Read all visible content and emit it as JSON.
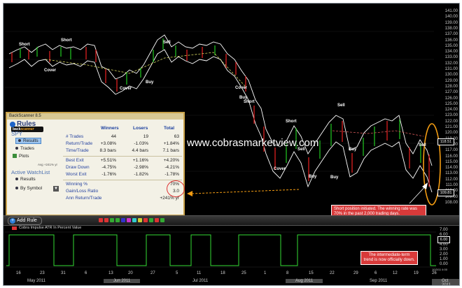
{
  "watermark": "www.cobrasmarketview.com",
  "y_axis_labels": [
    "141.00",
    "140.00",
    "139.00",
    "138.00",
    "137.00",
    "136.00",
    "135.00",
    "134.00",
    "133.00",
    "132.00",
    "131.00",
    "130.00",
    "129.00",
    "128.00",
    "127.00",
    "126.00",
    "125.00",
    "124.00",
    "123.00",
    "122.00",
    "121.00",
    "120.00",
    "119.00",
    "118.00",
    "117.00",
    "116.00",
    "115.00",
    "114.00",
    "113.00",
    "112.00",
    "111.00",
    "110.00",
    "109.00",
    "108.00"
  ],
  "price_boxes": {
    "upper": "118.51",
    "lower": "109.81"
  },
  "signals": [
    "Short",
    "Short",
    "Sell",
    "Cover",
    "Cover",
    "Buy",
    "Cover",
    "Buy",
    "Short",
    "Short",
    "Sell",
    "Cover",
    "Buy",
    "Sell",
    "Buy",
    "Buy",
    "Sell"
  ],
  "toolbar": {
    "add_rule": "Add Rule",
    "chip_colors": [
      "#d33",
      "#d33",
      "#3a3",
      "#3a3",
      "#33c",
      "#c3c",
      "#3cc",
      "#cc3",
      "#d33",
      "#3a3",
      "#d33",
      "#3a3"
    ]
  },
  "panel": {
    "title": "BackScanner 8.5",
    "logo_prefix": "back",
    "logo_brand": "scanner",
    "rules_heading": "Rules",
    "symbol": "SPY",
    "nav": {
      "results": "Results",
      "trades": "Trades",
      "plots": "Plots"
    },
    "avg_note": "Avg +241% yr",
    "watchlist_heading": "Active WatchList",
    "watchlist_nav": {
      "results": "Results",
      "by_symbol": "By Symbol"
    },
    "columns": [
      "Winners",
      "Losers",
      "Total"
    ],
    "rows": [
      {
        "label": "# Trades",
        "values": [
          "44",
          "19",
          "63"
        ]
      },
      {
        "label": "Return/Trade",
        "values": [
          "+3.08%",
          "-1.03%",
          "+1.84%"
        ]
      },
      {
        "label": "Time/Trade",
        "values": [
          "8.3 bars",
          "4.4 bars",
          "7.1 bars"
        ]
      },
      {
        "label": "Best Exit",
        "values": [
          "+5.51%",
          "+1.16%",
          "+4.20%"
        ]
      },
      {
        "label": "Draw Down",
        "values": [
          "-4.75%",
          "-2.98%",
          "-4.21%"
        ]
      },
      {
        "label": "Worst Exit",
        "values": [
          "-1.76%",
          "-1.82%",
          "-1.78%"
        ]
      }
    ],
    "summary": [
      {
        "label": "Winning %",
        "value": "70%"
      },
      {
        "label": "Gain/Loss Ratio",
        "value": "3.0"
      },
      {
        "label": "Ann Return/Trade",
        "value": "+241% yr"
      }
    ]
  },
  "indicator": {
    "legend": "Cobra Impulse  ATR In Percent Value",
    "y_labels": [
      "7.00",
      "6.00",
      "5.00",
      "4.00",
      "3.00",
      "2.00",
      "1.00",
      "0.00"
    ],
    "value_box": "6.00",
    "right_small": "10/3/11 4:00"
  },
  "annotations": {
    "short_note": "Short position initiated. The winning rate was 70% in the past 2,000 trading days.",
    "trend_note": "The intermediate-term trend is now officially down."
  },
  "x_axis": {
    "days": [
      "16",
      "23",
      "31",
      "6",
      "13",
      "20",
      "27",
      "5",
      "11",
      "18",
      "25",
      "1",
      "8",
      "15",
      "22",
      "29",
      "6",
      "12",
      "19",
      "26"
    ],
    "months": [
      "May 2011",
      "Jun 2011",
      "Jul 2011",
      "Aug 2011",
      "Sep 2011",
      "Oct 2011"
    ]
  }
}
